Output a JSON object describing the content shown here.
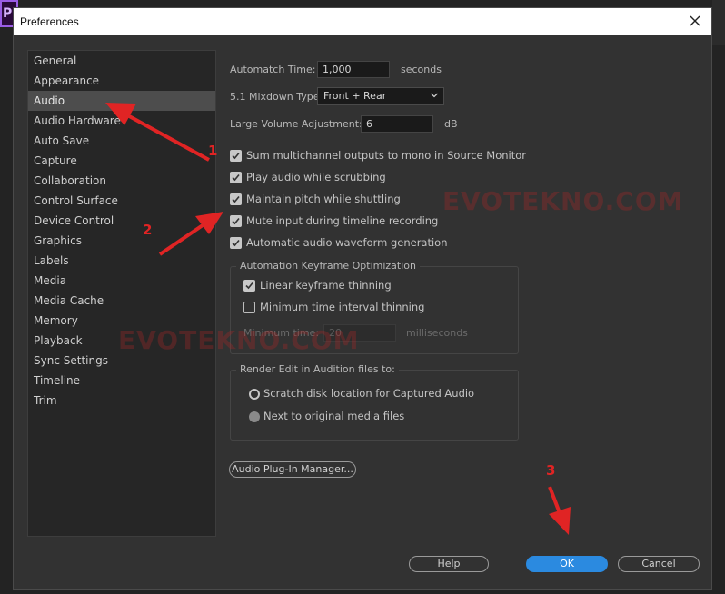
{
  "app": {
    "logo_text": "Pr"
  },
  "dialog": {
    "title": "Preferences"
  },
  "sidebar": {
    "items": [
      {
        "label": "General"
      },
      {
        "label": "Appearance"
      },
      {
        "label": "Audio",
        "selected": true
      },
      {
        "label": "Audio Hardware"
      },
      {
        "label": "Auto Save"
      },
      {
        "label": "Capture"
      },
      {
        "label": "Collaboration"
      },
      {
        "label": "Control Surface"
      },
      {
        "label": "Device Control"
      },
      {
        "label": "Graphics"
      },
      {
        "label": "Labels"
      },
      {
        "label": "Media"
      },
      {
        "label": "Media Cache"
      },
      {
        "label": "Memory"
      },
      {
        "label": "Playback"
      },
      {
        "label": "Sync Settings"
      },
      {
        "label": "Timeline"
      },
      {
        "label": "Trim"
      }
    ]
  },
  "audio": {
    "automatch_label": "Automatch Time:",
    "automatch_value": "1,000",
    "automatch_unit": "seconds",
    "mixdown_label": "5.1 Mixdown Type:",
    "mixdown_value": "Front + Rear",
    "volume_label": "Large Volume Adjustment:",
    "volume_value": "6",
    "volume_unit": "dB",
    "checkboxes": [
      {
        "label": "Sum multichannel outputs to mono in Source Monitor",
        "checked": true
      },
      {
        "label": "Play audio while scrubbing",
        "checked": true
      },
      {
        "label": "Maintain pitch while shuttling",
        "checked": true
      },
      {
        "label": "Mute input during timeline recording",
        "checked": true
      },
      {
        "label": "Automatic audio waveform generation",
        "checked": true
      }
    ],
    "keyframe_group": {
      "title": "Automation Keyframe Optimization",
      "linear_label": "Linear keyframe thinning",
      "linear_checked": true,
      "mintime_label": "Minimum time interval thinning",
      "mintime_checked": false,
      "min_time_label": "Minimum time:",
      "min_time_value": "20",
      "min_time_unit": "milliseconds"
    },
    "render_group": {
      "title": "Render Edit in Audition files to:",
      "option1": "Scratch disk location for Captured Audio",
      "option2": "Next to original media files",
      "selected": "option2"
    },
    "plugin_button": "Audio Plug-In Manager..."
  },
  "footer": {
    "help": "Help",
    "ok": "OK",
    "cancel": "Cancel"
  },
  "watermark": {
    "text": "EVOTEKNO.COM"
  },
  "annotations": {
    "n1": "1",
    "n2": "2",
    "n3": "3",
    "color": "#e02424"
  },
  "colors": {
    "accent": "#2b8ae0",
    "selected_item": "#4d4d4d",
    "dialog_bg": "#323232"
  }
}
